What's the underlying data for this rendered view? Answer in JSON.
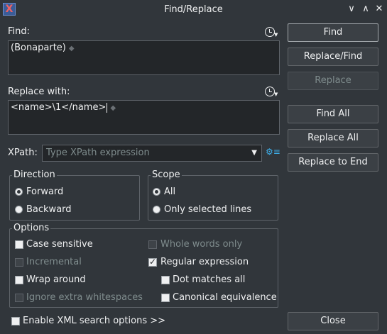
{
  "window": {
    "title": "Find/Replace",
    "controls": {
      "minimize": "∨",
      "maximize": "∧",
      "close": "✕"
    }
  },
  "find": {
    "label": "Find:",
    "value": "(Bonaparte)"
  },
  "replace": {
    "label": "Replace with:",
    "value": "<name>\\1</name>"
  },
  "xpath": {
    "label": "XPath:",
    "placeholder": "Type XPath expression"
  },
  "direction": {
    "title": "Direction",
    "options": [
      {
        "label": "Forward",
        "selected": true
      },
      {
        "label": "Backward",
        "selected": false
      }
    ]
  },
  "scope": {
    "title": "Scope",
    "options": [
      {
        "label": "All",
        "selected": true
      },
      {
        "label": "Only selected lines",
        "selected": false
      }
    ]
  },
  "options": {
    "title": "Options",
    "case_sensitive": "Case sensitive",
    "whole_words": "Whole words only",
    "incremental": "Incremental",
    "regex": "Regular expression",
    "wrap": "Wrap around",
    "dot_all": "Dot matches all",
    "ignore_ws": "Ignore extra whitespaces",
    "canonical": "Canonical equivalence"
  },
  "xml_options": "Enable XML search options >>",
  "buttons": {
    "find": "Find",
    "replace_find": "Replace/Find",
    "replace": "Replace",
    "find_all": "Find All",
    "replace_all": "Replace All",
    "replace_to_end": "Replace to End",
    "close": "Close"
  },
  "icons": {
    "app": "oxygen-x-icon",
    "history": "history-icon",
    "settings": "gear-icon"
  },
  "colors": {
    "background": "#31363b",
    "field": "#232629",
    "border": "#5e6369",
    "text": "#eff0f1",
    "disabled": "#7f8c8d",
    "accent": "#3daee9"
  }
}
